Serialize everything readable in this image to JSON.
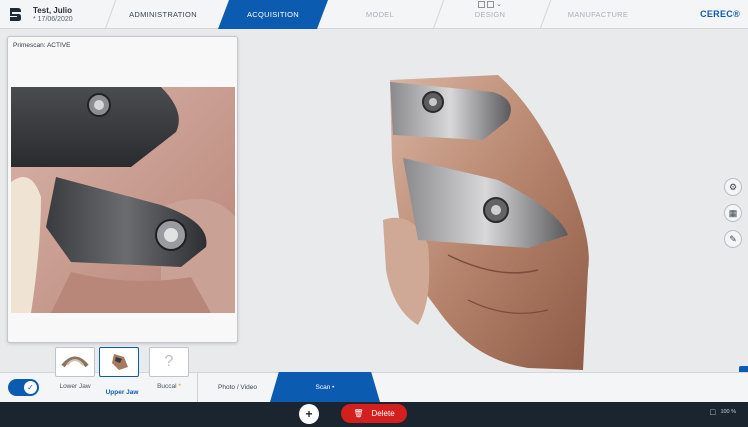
{
  "header": {
    "patient_name": "Test, Julio",
    "patient_date": "* 17/06/2020",
    "steps": [
      "ADMINISTRATION",
      "ACQUISITION",
      "MODEL",
      "DESIGN",
      "MANUFACTURE"
    ],
    "brand": "CEREC®"
  },
  "preview": {
    "title": "Primescan: ACTIVE"
  },
  "catalog": {
    "items": [
      {
        "label": "Lower Jaw",
        "selected": false
      },
      {
        "label": "Upper Jaw",
        "selected": true
      },
      {
        "label": "Buccal",
        "selected": false
      }
    ],
    "buccal_marker": "*"
  },
  "steps_bar": {
    "photo": "Photo / Video",
    "scan": "Scan •"
  },
  "bottom": {
    "delete_label": "Delete",
    "battery": "100 %"
  },
  "colors": {
    "accent": "#0b5cb1",
    "delete": "#d41f1f",
    "bottom_bar": "#1b2530"
  }
}
